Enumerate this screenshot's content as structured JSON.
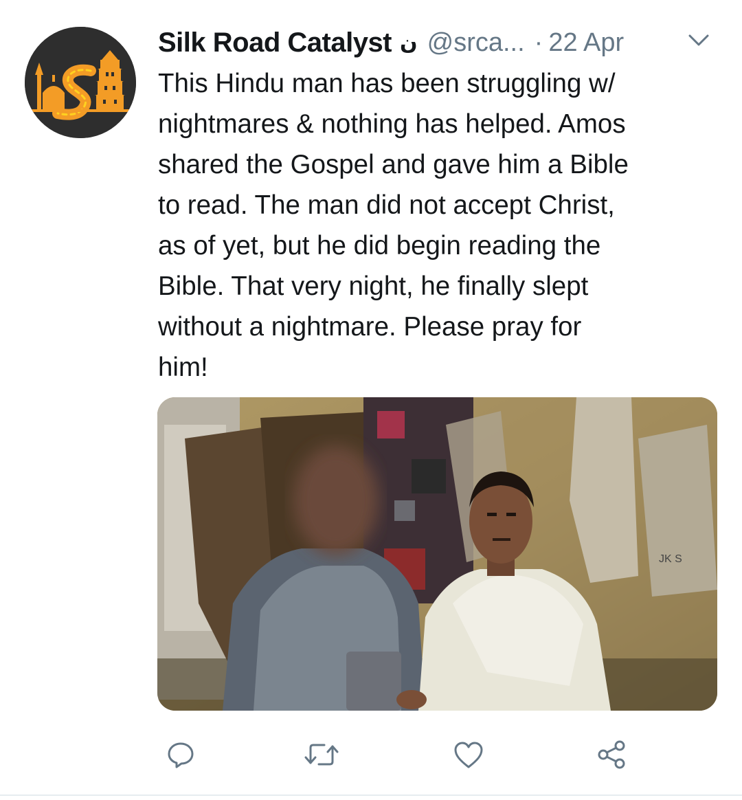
{
  "tweet": {
    "display_name": "Silk Road Catalyst",
    "name_glyph": "ن",
    "handle": "@srca...",
    "separator": "·",
    "date": "22 Apr",
    "text": "This Hindu man has been struggling w/\nnightmares & nothing has helped. Amos\nshared the Gospel and gave him a Bible\nto read. The man did not accept Christ,\nas of yet, but he did begin reading the\nBible. That very night, he finally slept\nwithout a nightmare. Please pray for\nhim!"
  },
  "avatar": {
    "logo_letters": "LS",
    "colors": {
      "background": "#2e2e2e",
      "accent": "#f39c26",
      "highlight": "#ffd21f"
    }
  },
  "photo": {
    "bag_print": "JK S"
  },
  "actions": {
    "icons": [
      "reply-icon",
      "retweet-icon",
      "like-icon",
      "share-icon"
    ]
  },
  "colors": {
    "text_primary": "#14171a",
    "text_secondary": "#657786",
    "icon": "#657786",
    "divider": "#e6ecf0"
  }
}
